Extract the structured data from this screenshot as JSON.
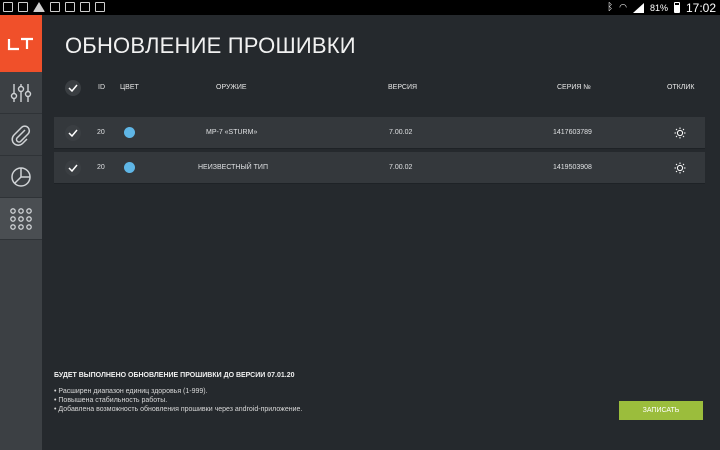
{
  "status_bar": {
    "battery": "81%",
    "time": "17:02"
  },
  "page": {
    "title": "ОБНОВЛЕНИЕ ПРОШИВКИ"
  },
  "table": {
    "columns": {
      "id": "ID",
      "color": "ЦВЕТ",
      "weapon": "ОРУЖИЕ",
      "version": "ВЕРСИЯ",
      "serial": "СЕРИЯ №",
      "response": "ОТКЛИК"
    },
    "rows": [
      {
        "id": "20",
        "color": "#5fb6e6",
        "weapon": "MP-7 «STURM»",
        "version": "7.00.02",
        "serial": "1417603789"
      },
      {
        "id": "20",
        "color": "#5fb6e6",
        "weapon": "НЕИЗВЕСТНЫЙ ТИП",
        "version": "7.00.02",
        "serial": "1419503908"
      }
    ]
  },
  "info": {
    "title": "БУДЕТ ВЫПОЛНЕНО ОБНОВЛЕНИЕ ПРОШИВКИ ДО ВЕРСИИ 07.01.20",
    "items": [
      "• Расширен диапазон единиц здоровья (1-999).",
      "• Повышена стабильность работы.",
      "• Добавлена возможность обновления прошивки через android-приложение."
    ]
  },
  "actions": {
    "write_label": "ЗАПИСАТЬ"
  },
  "colors": {
    "brand": "#f0502a",
    "accent_button": "#9bbd3c",
    "row_dot": "#5fb6e6"
  }
}
